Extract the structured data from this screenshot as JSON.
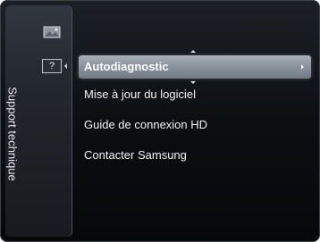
{
  "sidebar": {
    "title": "Support technique",
    "icons": [
      {
        "name": "picture-icon"
      },
      {
        "name": "help-icon",
        "glyph": "?"
      }
    ]
  },
  "menu": {
    "items": [
      {
        "label": "Autodiagnostic",
        "selected": true
      },
      {
        "label": "Mise à jour du logiciel",
        "selected": false
      },
      {
        "label": "Guide de connexion HD",
        "selected": false
      },
      {
        "label": "Contacter Samsung",
        "selected": false
      }
    ]
  }
}
